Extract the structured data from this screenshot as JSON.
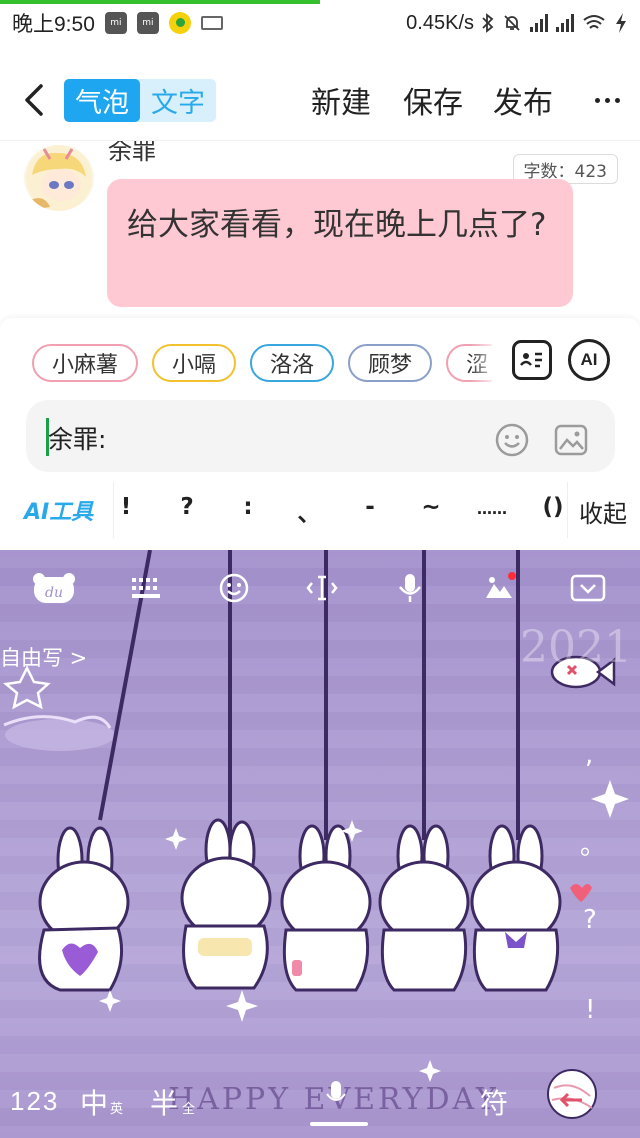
{
  "status_bar": {
    "time": "晚上9:50",
    "speed": "0.45K/s"
  },
  "header": {
    "back_icon": "chevron-left-icon",
    "tabs": [
      {
        "label": "气泡",
        "active": true
      },
      {
        "label": "文字",
        "active": false
      }
    ],
    "actions": {
      "new": "新建",
      "save": "保存",
      "publish": "发布"
    },
    "more_icon": "more-horizontal-icon"
  },
  "chat": {
    "sender": "余罪",
    "char_count": "字数：423",
    "message": "给大家看看，现在晚上几点了?"
  },
  "composer": {
    "characters": [
      {
        "name": "小麻薯",
        "color": "#f0a0b0"
      },
      {
        "name": "小嗝",
        "color": "#f2c12e"
      },
      {
        "name": "洛洛",
        "color": "#3aa6e0"
      },
      {
        "name": "顾梦",
        "color": "#8ba0c8"
      },
      {
        "name": "涩",
        "color": "#f0a0b0"
      }
    ],
    "ai_button": "AI",
    "input_text": "余罪:",
    "ai_tools": "AI工具",
    "punctuation": [
      "!",
      "?",
      ":",
      "、",
      "-",
      "~",
      "……",
      "()"
    ],
    "collapse": "收起"
  },
  "keyboard": {
    "free_write": "自由写 >",
    "bottom": {
      "num": "123",
      "zh": "中",
      "zh_sub": "英",
      "half": "半",
      "half_sub": "全",
      "sym": "符"
    },
    "banner": "HAPPY EVERYDAY",
    "watermark": "2021",
    "side_glyphs": [
      ",",
      "。",
      "?",
      "!"
    ],
    "accent": "#a491cd"
  },
  "colors": {
    "brand_blue": "#1ea6f0",
    "bubble_pink": "#ffc9d4"
  }
}
